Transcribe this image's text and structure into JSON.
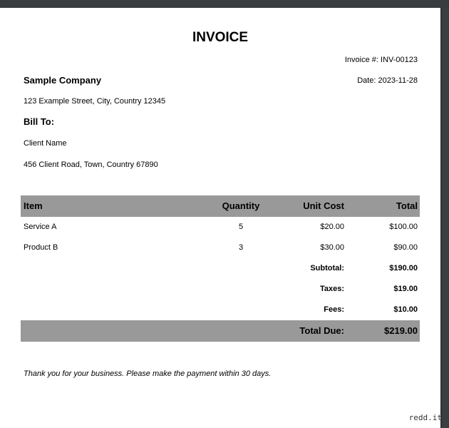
{
  "invoice": {
    "title": "INVOICE",
    "number": "Invoice #: INV-00123",
    "date": "Date: 2023-11-28",
    "company": {
      "name": "Sample Company",
      "address": "123 Example Street, City, Country 12345"
    },
    "bill_to": {
      "label": "Bill To:",
      "name": "Client Name",
      "address": "456 Client Road, Town, Country 67890"
    },
    "table": {
      "headers": [
        "Item",
        "Quantity",
        "Unit Cost",
        "Total"
      ],
      "rows": [
        {
          "item": "Service A",
          "quantity": "5",
          "unit_cost": "$20.00",
          "total": "$100.00"
        },
        {
          "item": "Product B",
          "quantity": "3",
          "unit_cost": "$30.00",
          "total": "$90.00"
        }
      ],
      "summary": [
        {
          "label": "Subtotal:",
          "value": "$190.00"
        },
        {
          "label": "Taxes:",
          "value": "$19.00"
        },
        {
          "label": "Fees:",
          "value": "$10.00"
        }
      ],
      "total_due": {
        "label": "Total Due:",
        "value": "$219.00"
      }
    },
    "footer_note": "Thank you for your business. Please make the payment within 30 days."
  },
  "watermark": "redd.it",
  "colors": {
    "header_bg": "#999999",
    "viewer_bg": "#3c3f41"
  }
}
